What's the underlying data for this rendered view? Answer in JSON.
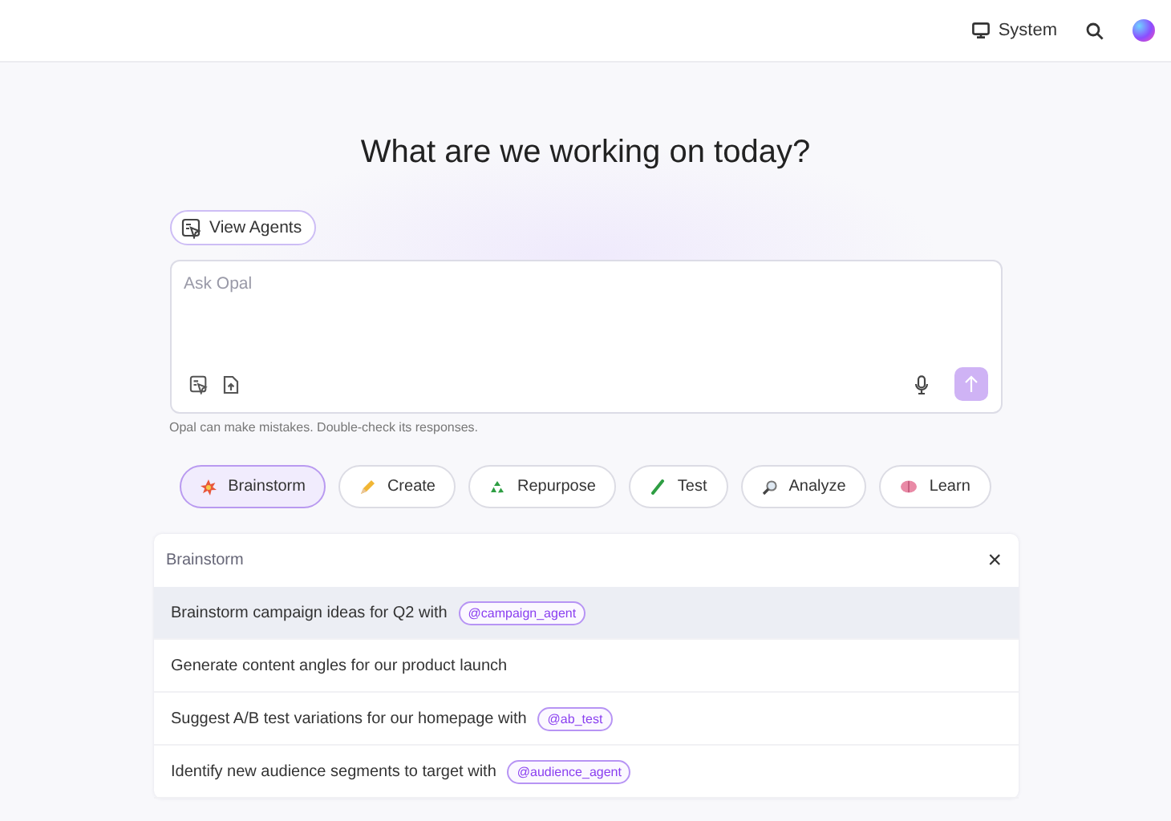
{
  "header": {
    "theme_label": "System"
  },
  "title": "What are we working on today?",
  "view_agents": "View Agents",
  "prompt": {
    "placeholder": "Ask Opal"
  },
  "disclaimer": "Opal can make mistakes. Double-check its responses.",
  "chips": [
    {
      "label": "Brainstorm",
      "selected": true
    },
    {
      "label": "Create",
      "selected": false
    },
    {
      "label": "Repurpose",
      "selected": false
    },
    {
      "label": "Test",
      "selected": false
    },
    {
      "label": "Analyze",
      "selected": false
    },
    {
      "label": "Learn",
      "selected": false
    }
  ],
  "panel": {
    "title": "Brainstorm",
    "close": "×",
    "suggestions": [
      {
        "text": "Brainstorm campaign ideas for Q2 with",
        "agent": "@campaign_agent",
        "selected": true
      },
      {
        "text": "Generate content angles for our product launch",
        "selected": false
      },
      {
        "text": "Suggest A/B test variations for our homepage with",
        "agent": "@ab_test",
        "selected": false
      },
      {
        "text": "Identify new audience segments to target with",
        "agent": "@audience_agent",
        "selected": false
      }
    ]
  }
}
